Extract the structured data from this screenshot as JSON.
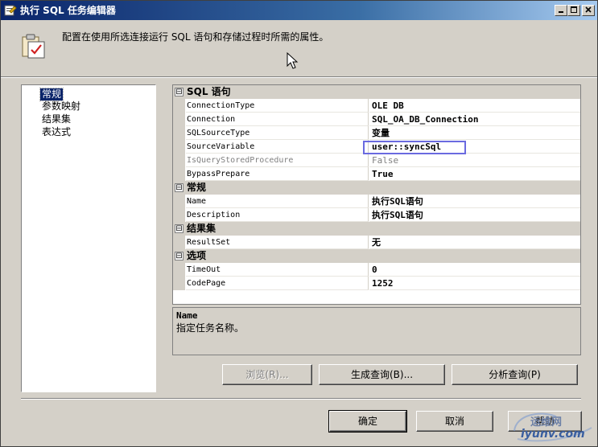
{
  "window": {
    "title": "执行 SQL 任务编辑器",
    "header_description": "配置在使用所选连接运行 SQL 语句和存储过程时所需的属性。"
  },
  "nav": {
    "items": [
      {
        "label": "常规",
        "selected": true
      },
      {
        "label": "参数映射",
        "selected": false
      },
      {
        "label": "结果集",
        "selected": false
      },
      {
        "label": "表达式",
        "selected": false
      }
    ]
  },
  "grid": {
    "categories": [
      {
        "label": "SQL 语句",
        "properties": [
          {
            "name": "ConnectionType",
            "value": "OLE DB"
          },
          {
            "name": "Connection",
            "value": "SQL_OA_DB_Connection"
          },
          {
            "name": "SQLSourceType",
            "value": "变量"
          },
          {
            "name": "SourceVariable",
            "value": "user::syncSql"
          },
          {
            "name": "IsQueryStoredProcedure",
            "value": "False"
          },
          {
            "name": "BypassPrepare",
            "value": "True"
          }
        ]
      },
      {
        "label": "常规",
        "properties": [
          {
            "name": "Name",
            "value": "执行SQL语句"
          },
          {
            "name": "Description",
            "value": "执行SQL语句"
          }
        ]
      },
      {
        "label": "结果集",
        "properties": [
          {
            "name": "ResultSet",
            "value": "无"
          }
        ]
      },
      {
        "label": "选项",
        "properties": [
          {
            "name": "TimeOut",
            "value": "0"
          },
          {
            "name": "CodePage",
            "value": "1252"
          }
        ]
      }
    ],
    "collapse_glyph": "⊟"
  },
  "description_panel": {
    "title": "Name",
    "text": "指定任务名称。"
  },
  "buttons": {
    "browse": "浏览(R)...",
    "build_query": "生成查询(B)...",
    "parse_query": "分析查询(P)",
    "ok": "确定",
    "cancel": "取消",
    "help": "帮助"
  },
  "watermark": {
    "cn": "运维网",
    "en": "iyunv.com"
  },
  "colors": {
    "title_gradient_start": "#0a246a",
    "selection": "#0a246a",
    "highlight_box": "#6a6ae0"
  }
}
